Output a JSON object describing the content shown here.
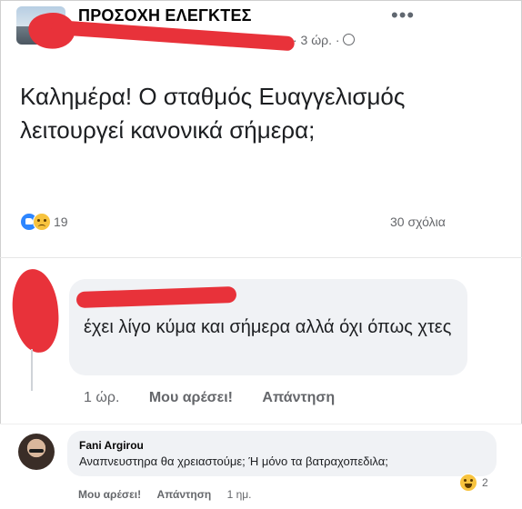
{
  "post": {
    "group_name": "ΠΡΟΣΟΧΗ ΕΛΕΓΚΤΕΣ",
    "time": "· 3 ώρ. ·",
    "more_label": "•••",
    "text": "Καλημέρα! Ο σταθμός Ευαγγελισμός λειτουργεί κανονικά σήμερα;",
    "reaction_count": "19",
    "comment_count": "30 σχόλια",
    "reaction_icons": [
      "like-icon",
      "sad-icon"
    ]
  },
  "comment1": {
    "text": "έχει λίγο κύμα και σήμερα αλλά όχι όπως χτες",
    "time": "1 ώρ.",
    "like_label": "Μου αρέσει!",
    "reply_label": "Απάντηση"
  },
  "comment2": {
    "name": "Fani Argirou",
    "text": "Αναπνευστηρα θα χρειαστούμε; Ή μόνο τα βατραχοπεδιλα;",
    "reaction_count": "2",
    "reaction_icon": "laugh-icon",
    "like_label": "Μου αρέσει!",
    "reply_label": "Απάντηση",
    "time": "1 ημ."
  },
  "colors": {
    "redaction": "#e8323a",
    "bubble": "#f0f2f5",
    "secondary_text": "#65676b",
    "like_blue": "#2d86ff",
    "emoji_yellow": "#f7c33e"
  }
}
